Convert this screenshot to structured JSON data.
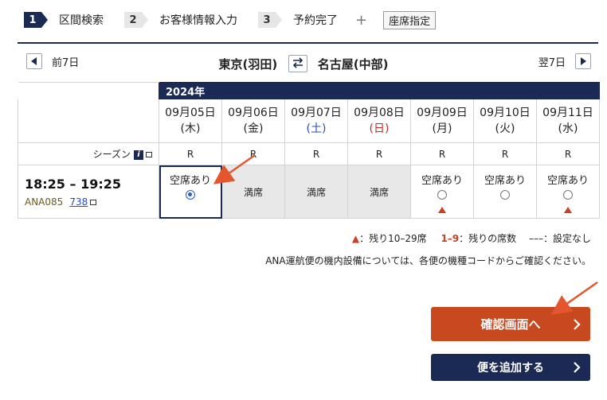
{
  "steps": [
    {
      "num": "1",
      "label": "区間検索",
      "active": true
    },
    {
      "num": "2",
      "label": "お客様情報入力",
      "active": false
    },
    {
      "num": "3",
      "label": "予約完了",
      "active": false
    }
  ],
  "steps_plus": "+",
  "seat_select_label": "座席指定",
  "nav": {
    "prev_label": "前7日",
    "next_label": "翌7日",
    "origin": "東京(羽田)",
    "destination": "名古屋(中部)"
  },
  "year_label": "2024年",
  "dates": [
    {
      "date": "09月05日",
      "dow": "(木)",
      "type": "weekday"
    },
    {
      "date": "09月06日",
      "dow": "(金)",
      "type": "weekday"
    },
    {
      "date": "09月07日",
      "dow": "(土)",
      "type": "sat"
    },
    {
      "date": "09月08日",
      "dow": "(日)",
      "type": "sun"
    },
    {
      "date": "09月09日",
      "dow": "(月)",
      "type": "weekday"
    },
    {
      "date": "09月10日",
      "dow": "(火)",
      "type": "weekday"
    },
    {
      "date": "09月11日",
      "dow": "(水)",
      "type": "weekday"
    }
  ],
  "season_label": "シーズン",
  "seasons": [
    "R",
    "R",
    "R",
    "R",
    "R",
    "R",
    "R"
  ],
  "flight": {
    "time": "18:25 – 19:25",
    "number": "ANA085",
    "aircraft": "738"
  },
  "availability": [
    {
      "status": "空席あり",
      "kind": "available",
      "selected": true,
      "few_seats": false
    },
    {
      "status": "満席",
      "kind": "full",
      "selected": false,
      "few_seats": false
    },
    {
      "status": "満席",
      "kind": "full",
      "selected": false,
      "few_seats": false
    },
    {
      "status": "満席",
      "kind": "full",
      "selected": false,
      "few_seats": false
    },
    {
      "status": "空席あり",
      "kind": "available",
      "selected": false,
      "few_seats": true
    },
    {
      "status": "空席あり",
      "kind": "available",
      "selected": false,
      "few_seats": false
    },
    {
      "status": "空席あり",
      "kind": "available",
      "selected": false,
      "few_seats": true
    }
  ],
  "legend": {
    "tri_text": "：残り10–29席",
    "range": "1–9",
    "range_text": "：残りの席数",
    "dash": "–––",
    "dash_text": "：設定なし"
  },
  "note": "ANA運航便の機内設備については、各便の機種コードからご確認ください。",
  "buttons": {
    "confirm": "確認画面へ",
    "add": "便を追加する"
  },
  "colors": {
    "navy": "#1b2a55",
    "confirm": "#c8481f",
    "arrow": "#e4572e"
  }
}
